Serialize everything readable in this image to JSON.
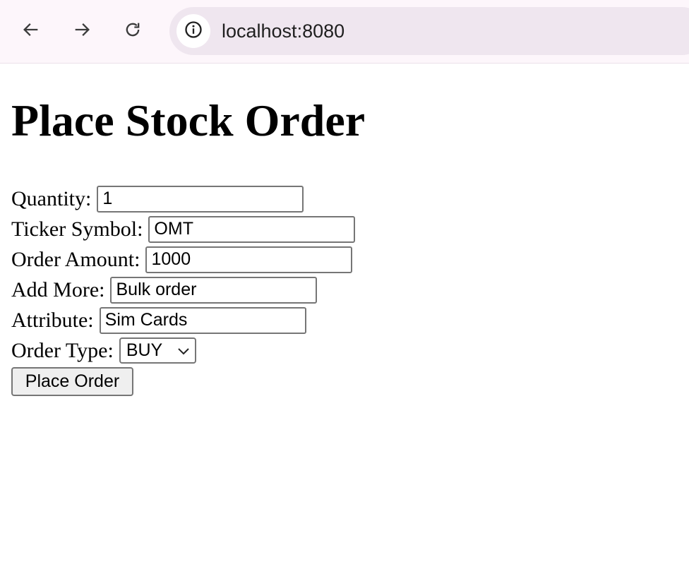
{
  "browser": {
    "url": "localhost:8080",
    "icons": {
      "back": "arrow-left-icon",
      "forward": "arrow-right-icon",
      "reload": "reload-icon",
      "site_info": "info-icon"
    }
  },
  "page": {
    "title": "Place Stock Order"
  },
  "form": {
    "quantity": {
      "label": "Quantity:",
      "value": "1"
    },
    "ticker": {
      "label": "Ticker Symbol:",
      "value": "OMT"
    },
    "amount": {
      "label": "Order Amount:",
      "value": "1000"
    },
    "add_more": {
      "label": "Add More:",
      "value": "Bulk order"
    },
    "attribute": {
      "label": "Attribute:",
      "value": "Sim Cards"
    },
    "order_type": {
      "label": "Order Type:",
      "selected": "BUY"
    },
    "submit_label": "Place Order"
  }
}
